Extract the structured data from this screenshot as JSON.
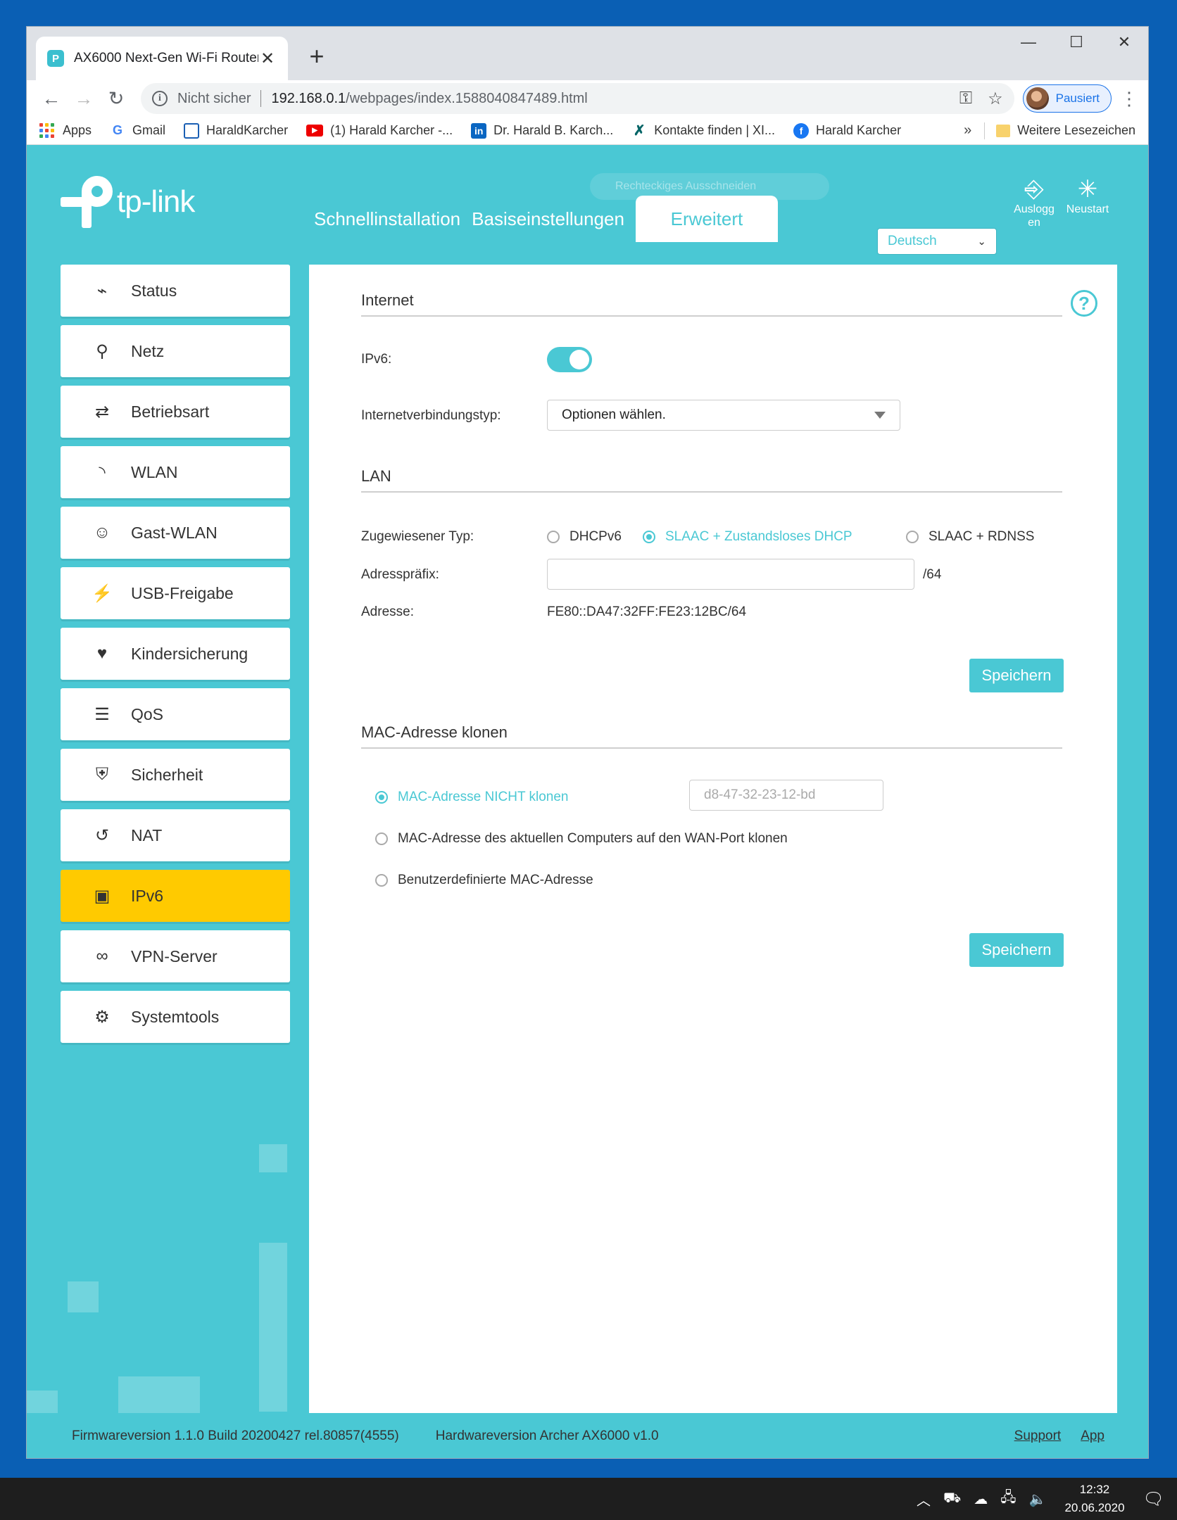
{
  "browser": {
    "tab_title": "AX6000 Next-Gen Wi-Fi Router",
    "not_secure": "Nicht sicher",
    "url_host": "192.168.0.1",
    "url_path": "/webpages/index.1588040847489.html",
    "profile_label": "Pausiert",
    "bookmarks": [
      "Apps",
      "Gmail",
      "HaraldKarcher",
      "(1) Harald Karcher -...",
      "Dr. Harald B. Karch...",
      "Kontakte finden | XI...",
      "Harald Karcher"
    ],
    "more_bookmarks": "»",
    "other_bookmarks": "Weitere Lesezeichen"
  },
  "header": {
    "logo_text": "tp-link",
    "snip_ghost": "Rechteckiges Ausschneiden",
    "nav": [
      "Schnellinstallation",
      "Basiseinstellungen",
      "Erweitert"
    ],
    "language": "Deutsch",
    "logout_label": "Ausloggen",
    "reboot_label": "Neustart"
  },
  "sidebar": {
    "items": [
      {
        "label": "Status",
        "icon": "pulse-icon"
      },
      {
        "label": "Netz",
        "icon": "network-icon"
      },
      {
        "label": "Betriebsart",
        "icon": "mode-icon"
      },
      {
        "label": "WLAN",
        "icon": "wifi-icon"
      },
      {
        "label": "Gast-WLAN",
        "icon": "guest-icon"
      },
      {
        "label": "USB-Freigabe",
        "icon": "usb-icon"
      },
      {
        "label": "Kindersicherung",
        "icon": "parental-icon"
      },
      {
        "label": "QoS",
        "icon": "qos-icon"
      },
      {
        "label": "Sicherheit",
        "icon": "shield-icon"
      },
      {
        "label": "NAT",
        "icon": "nat-icon"
      },
      {
        "label": "IPv6",
        "icon": "ipv6-icon"
      },
      {
        "label": "VPN-Server",
        "icon": "link-icon"
      },
      {
        "label": "Systemtools",
        "icon": "gear-icon"
      }
    ],
    "active_index": 10
  },
  "internet": {
    "title": "Internet",
    "ipv6_label": "IPv6:",
    "ipv6_enabled": true,
    "conn_type_label": "Internetverbindungstyp:",
    "conn_type_value": "Optionen wählen."
  },
  "lan": {
    "title": "LAN",
    "assigned_type_label": "Zugewiesener Typ:",
    "options": [
      "DHCPv6",
      "SLAAC + Zustandsloses DHCP",
      "SLAAC + RDNSS"
    ],
    "selected": 1,
    "prefix_label": "Adresspräfix:",
    "prefix_value": "",
    "prefix_suffix": "/64",
    "address_label": "Adresse:",
    "address_value": "FE80::DA47:32FF:FE23:12BC/64",
    "save_label": "Speichern"
  },
  "mac": {
    "title": "MAC-Adresse klonen",
    "options": [
      "MAC-Adresse NICHT klonen",
      "MAC-Adresse des aktuellen Computers auf den WAN-Port klonen",
      "Benutzerdefinierte MAC-Adresse"
    ],
    "selected": 0,
    "mac_value": "d8-47-32-23-12-bd",
    "save_label": "Speichern"
  },
  "footer": {
    "firmware": "Firmwareversion 1.1.0 Build 20200427 rel.80857(4555)",
    "hardware": "Hardwareversion Archer AX6000 v1.0",
    "support": "Support",
    "app": "App"
  },
  "taskbar": {
    "time": "12:32",
    "date": "20.06.2020"
  },
  "colors": {
    "accent": "#4ac8d4",
    "active_nav": "#ffca00"
  }
}
